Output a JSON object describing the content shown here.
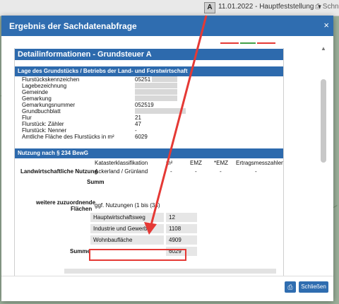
{
  "topbar": {
    "badge": "A",
    "date_select": "11.01.2022 - Hauptfeststellung",
    "print_label": "Schn"
  },
  "dialog": {
    "title": "Ergebnis der Sachdatenabfrage",
    "close": "×",
    "print_button": "⎙",
    "close_button": "Schließen"
  },
  "report": {
    "main_title": "Detailinformationen - Grundsteuer A",
    "lage_title": "Lage des Grundstücks / Betriebs der Land- und Forstwirtschaft",
    "lage_labels": [
      "Flurstückskennzeichen",
      "Lagebezeichnung",
      "Gemeinde",
      "Gemarkung",
      "Gemarkungsnummer",
      "Grundbuchblatt",
      "Flur",
      "Flurstück: Zähler",
      "Flurstück: Nenner",
      "Amtliche Fläche des Flurstücks in m²"
    ],
    "lage_values": [
      "05251",
      "",
      "",
      "",
      "052519",
      "",
      "21",
      "47",
      "-",
      "6029"
    ],
    "nutzung_title": "Nutzung nach § 234 BewG",
    "col_headers": [
      "Katasterklassifikation",
      "m²",
      "EMZ",
      "*EMZ",
      "Ertragsmesszahlen"
    ],
    "lw_label": "Landwirtschaftliche Nutzung",
    "lw_row": [
      "Ackerland / Grünland",
      "-",
      "-",
      "-",
      "-"
    ],
    "summe_partial": "Summ",
    "weitere_label_1": "weitere zuzuordnende",
    "weitere_label_2": "Flächen",
    "ggf": "ggf. Nutzungen (1 bis (34)",
    "rows": [
      {
        "name": "Hauptwirtschaftsweg",
        "val": "12"
      },
      {
        "name": "Industrie und Gewerbe",
        "val": "1108"
      },
      {
        "name": "Wohnbaufläche",
        "val": "4909"
      }
    ],
    "summe_label": "Summe",
    "summe_val": "6029"
  }
}
